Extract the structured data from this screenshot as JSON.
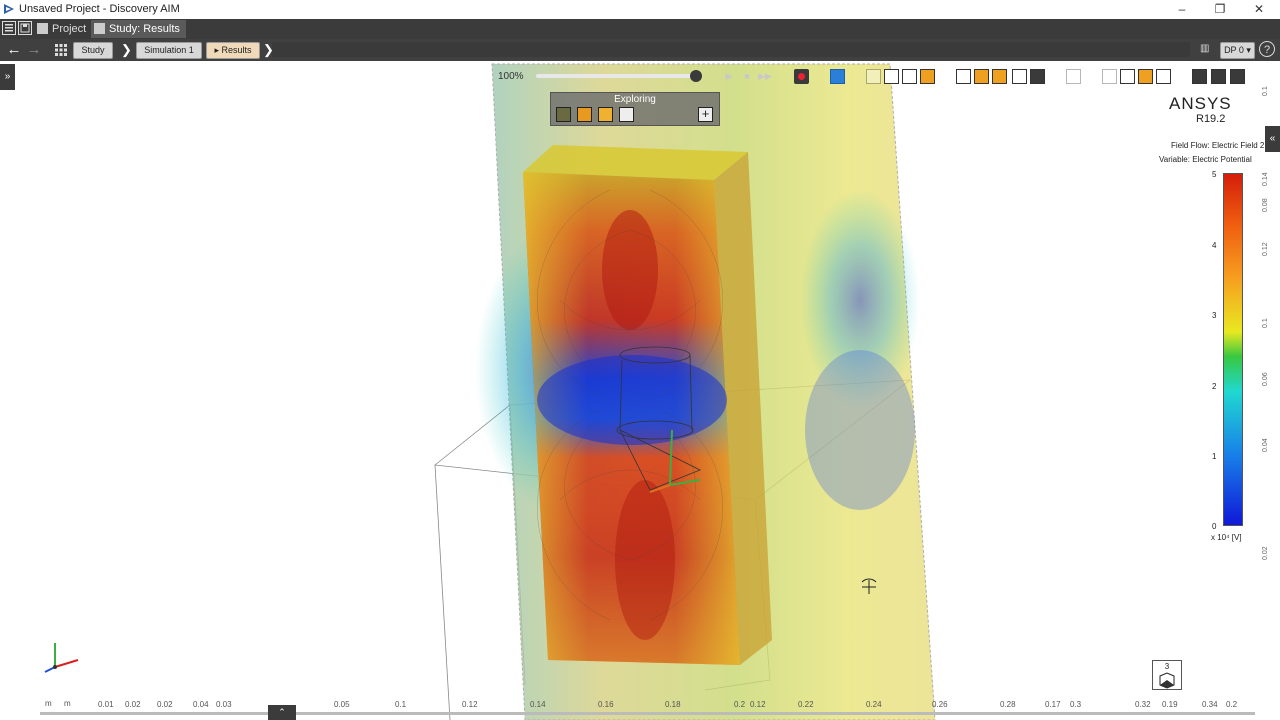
{
  "window": {
    "title": "Unsaved Project - Discovery AIM",
    "controls": [
      "–",
      "❐",
      "✕"
    ]
  },
  "tabs": [
    {
      "label": "Project",
      "active": false
    },
    {
      "label": "Study: Results",
      "active": true
    }
  ],
  "breadcrumb": {
    "items": [
      "Study",
      "Simulation 1",
      "▸ Results"
    ],
    "dp_label": "DP 0 ▾",
    "help": "?"
  },
  "playback": {
    "zoom": "100%",
    "progress": 1.0
  },
  "explore_panel": {
    "title": "Exploring",
    "add": "+"
  },
  "brand": {
    "name": "ANSYS",
    "version": "R19.2"
  },
  "legend": {
    "line1": "Field Flow: Electric Field 2",
    "line2": "Variable: Electric Potential",
    "ticks": [
      "5",
      "4",
      "3",
      "2",
      "1",
      "0"
    ],
    "unit": "x 10⁴ [V]",
    "colors": {
      "max": "#d41e0a",
      "min": "#1018d8"
    }
  },
  "ruler": {
    "units": [
      "m",
      "m"
    ],
    "bottom": [
      "0.01",
      "0.02",
      "0.02",
      "0.04",
      "0.03",
      "0.05",
      "0.1",
      "0.12",
      "0.14",
      "0.16",
      "0.18",
      "0.2",
      "0.12",
      "0.22",
      "0.24",
      "0.26",
      "0.28",
      "0.3",
      "0.17",
      "0.32",
      "0.19",
      "0.34",
      "0.2"
    ],
    "right": [
      "0.1",
      "0.14",
      "0.12",
      "0.1",
      "0.08",
      "0.06",
      "0.04",
      "0.02"
    ]
  },
  "view_cube": {
    "label": "3"
  },
  "side": {
    "left": "»",
    "right": "«"
  },
  "bottom_tab": "⌃"
}
